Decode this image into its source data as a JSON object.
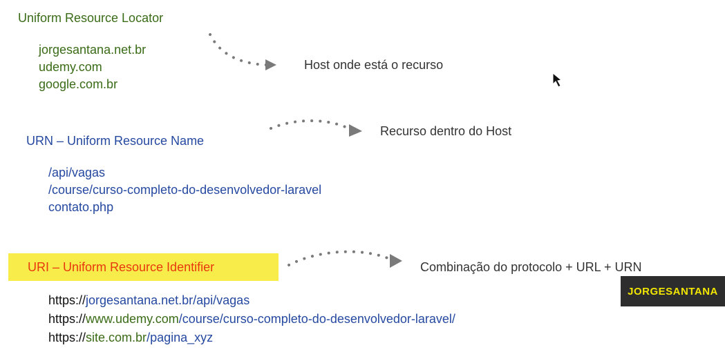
{
  "url_section": {
    "title": "Uniform Resource Locator",
    "items": [
      "jorgesantana.net.br",
      "udemy.com",
      "google.com.br"
    ],
    "note": "Host onde está o recurso"
  },
  "urn_section": {
    "title": "URN – Uniform Resource Name",
    "items": [
      "/api/vagas",
      "/course/curso-completo-do-desenvolvedor-laravel",
      "contato.php"
    ],
    "note": "Recurso dentro do Host"
  },
  "uri_section": {
    "title": "URI – Uniform Resource Identifier",
    "note": "Combinação do protocolo + URL + URN",
    "items": [
      {
        "protocol": "https://",
        "host": "jorgesantana.net.br",
        "path": "/api/vagas"
      },
      {
        "protocol": "https://",
        "host": "www.udemy.com",
        "path": "/course/curso-completo-do-desenvolvedor-laravel/"
      },
      {
        "protocol": "https://",
        "host": "site.com.br",
        "path": "/pagina_xyz"
      }
    ]
  },
  "watermark": "JORGESANTANA",
  "colors": {
    "url": "#3a6b16",
    "urn": "#2548a0",
    "uri": "#e8380d",
    "highlight": "#f7ec4a",
    "arrow": "#7a7a7a"
  }
}
